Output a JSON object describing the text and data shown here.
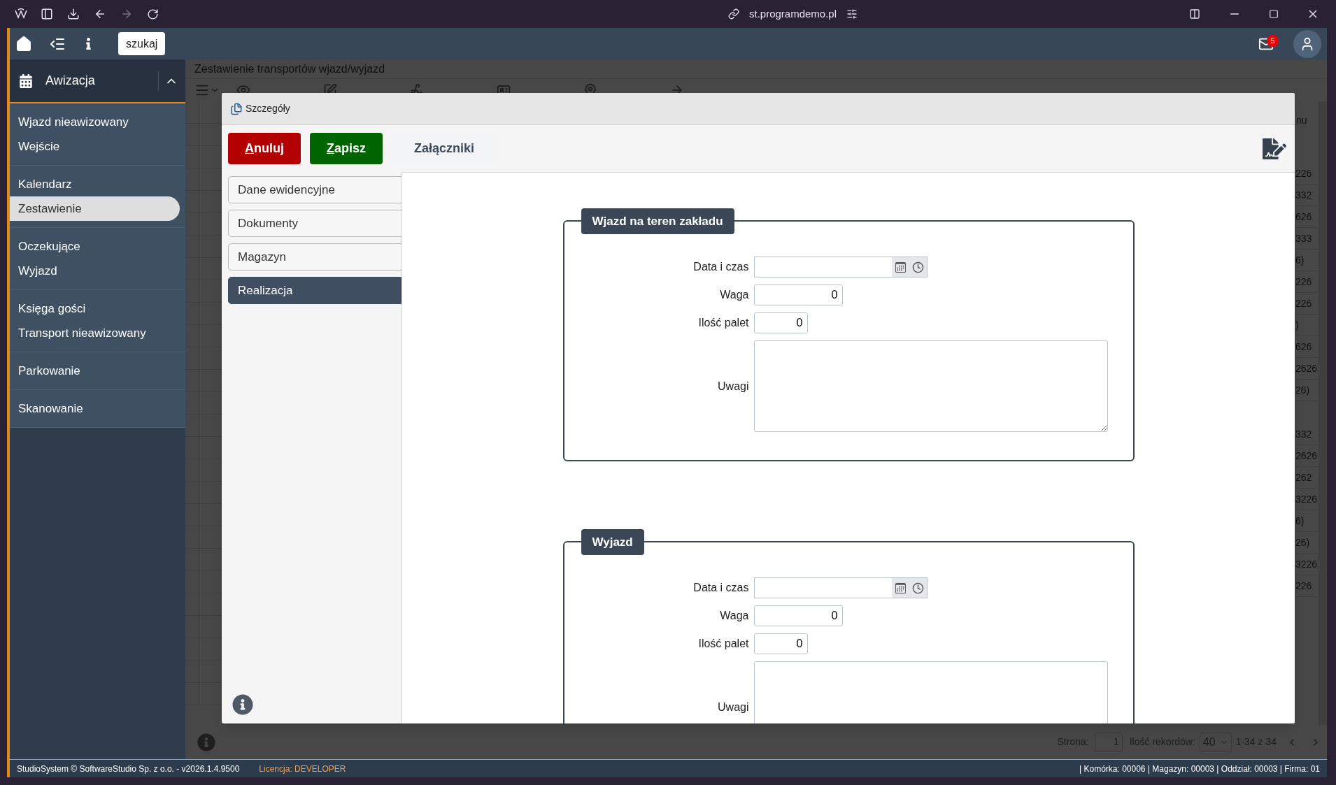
{
  "browser": {
    "url": "st.programdemo.pl"
  },
  "header": {
    "search_button": "szukaj",
    "mail_count": "5"
  },
  "sidebar": {
    "section": {
      "label": "Awizacja",
      "expanded": true
    },
    "groups": [
      [
        {
          "label": "Wjazd nieawizowany",
          "selected": false
        },
        {
          "label": "Wejście",
          "selected": false
        }
      ],
      [
        {
          "label": "Kalendarz",
          "selected": false
        },
        {
          "label": "Zestawienie",
          "selected": true
        }
      ],
      [
        {
          "label": "Oczekujące",
          "selected": false
        },
        {
          "label": "Wyjazd",
          "selected": false
        }
      ],
      [
        {
          "label": "Księga gości",
          "selected": false
        },
        {
          "label": "Transport nieawizowany",
          "selected": false
        }
      ],
      [
        {
          "label": "Parkowanie",
          "selected": false
        }
      ],
      [
        {
          "label": "Skanowanie",
          "selected": false
        }
      ]
    ]
  },
  "page": {
    "title": "Zestawienie transportów wjazd/wyjazd",
    "toolbar": [
      {
        "kind": "preview"
      },
      {
        "kind": "edit"
      },
      {
        "kind": "sign"
      },
      {
        "kind": "pass"
      },
      {
        "kind": "details"
      },
      {
        "kind": "status"
      }
    ],
    "table": {
      "column_header": "nu",
      "row_groups": [
        [
          "226",
          "332",
          "626",
          "333",
          "6)",
          "226",
          "226",
          ")",
          "626",
          "2626",
          "26)"
        ],
        [
          "332",
          "2626",
          "262",
          "3226",
          "6)",
          "26)",
          "3226",
          "226"
        ]
      ]
    },
    "pagination": {
      "page_label": "Strona:",
      "page": "1",
      "records_label": "Ilość rekordów:",
      "records": "40",
      "range": "1-34 z 34"
    }
  },
  "dialog": {
    "title": "Szczegóły",
    "buttons": [
      {
        "label": "Anuluj",
        "kind": "cancel",
        "hotkey_underlined": true
      },
      {
        "label": "Zapisz",
        "kind": "save",
        "hotkey_underlined": true
      },
      {
        "label": "Załączniki",
        "kind": "plain",
        "hotkey_underlined": false
      }
    ],
    "tabs": [
      {
        "label": "Dane ewidencyjne",
        "selected": false
      },
      {
        "label": "Dokumenty",
        "selected": false
      },
      {
        "label": "Magazyn",
        "selected": false
      },
      {
        "label": "Realizacja",
        "selected": true
      }
    ],
    "sections": [
      {
        "legend": "Wjazd na teren zakładu",
        "fields": [
          {
            "label": "Data i czas",
            "kind": "datetime"
          },
          {
            "label": "Waga",
            "kind": "wide_number",
            "value": "0"
          },
          {
            "label": "Ilość palet",
            "kind": "short_number",
            "value": "0"
          },
          {
            "label": "Uwagi",
            "kind": "textarea"
          }
        ]
      },
      {
        "legend": "Wyjazd",
        "fields": [
          {
            "label": "Data i czas",
            "kind": "datetime"
          },
          {
            "label": "Waga",
            "kind": "wide_number",
            "value": "0"
          },
          {
            "label": "Ilość palet",
            "kind": "short_number",
            "value": "0"
          },
          {
            "label": "Uwagi",
            "kind": "textarea"
          }
        ]
      }
    ]
  },
  "status_bar": {
    "copyright": "StudioSystem © SoftwareStudio Sp. z o.o. - v2026.1.4.9500",
    "license_label": "Licencja:",
    "license_value": "DEVELOPER",
    "info": "| Komórka: 00006 | Magazyn: 00003 | Oddział: 00003 | Firma: 01"
  }
}
